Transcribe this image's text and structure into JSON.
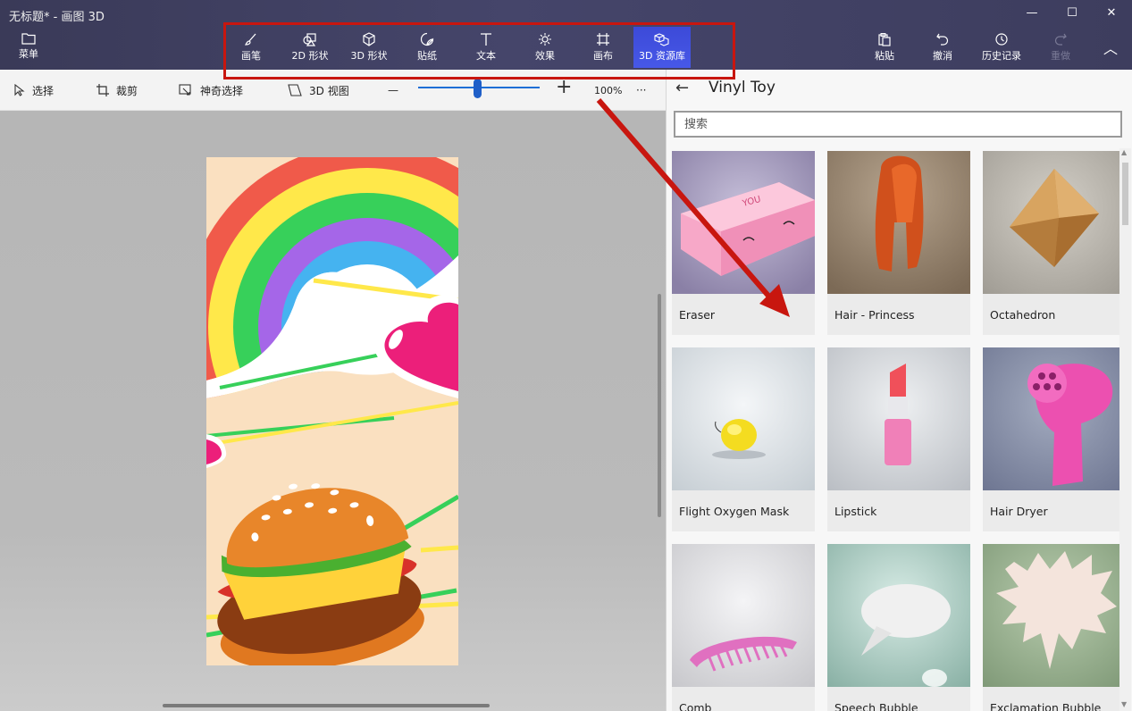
{
  "window": {
    "title": "无标题* - 画图 3D",
    "minimize": "—",
    "maximize": "☐",
    "close": "✕"
  },
  "ribbon": {
    "menu": "菜单",
    "tools": [
      {
        "label": "画笔",
        "icon": "brush-icon"
      },
      {
        "label": "2D 形状",
        "icon": "shapes-2d-icon"
      },
      {
        "label": "3D 形状",
        "icon": "cube-icon"
      },
      {
        "label": "贴纸",
        "icon": "sticker-icon"
      },
      {
        "label": "文本",
        "icon": "text-icon"
      },
      {
        "label": "效果",
        "icon": "effects-icon"
      },
      {
        "label": "画布",
        "icon": "canvas-icon"
      },
      {
        "label": "3D 资源库",
        "icon": "library-3d-icon",
        "active": true
      }
    ],
    "paste": "粘贴",
    "undo": "撤消",
    "history": "历史记录",
    "redo": "重做",
    "collapse": "︿"
  },
  "toolbar": {
    "select": "选择",
    "crop": "裁剪",
    "magic_select": "神奇选择",
    "view_3d": "3D 视图",
    "zoom_out": "—",
    "zoom_in": "+",
    "zoom_value": "100%",
    "zoom_fraction": 0.49,
    "more": "···"
  },
  "panel": {
    "back": "←",
    "title": "Vinyl Toy",
    "search_placeholder": "搜索",
    "items": [
      {
        "label": "Eraser"
      },
      {
        "label": "Hair - Princess"
      },
      {
        "label": "Octahedron"
      },
      {
        "label": "Flight Oxygen Mask"
      },
      {
        "label": "Lipstick"
      },
      {
        "label": "Hair Dryer"
      },
      {
        "label": "Comb"
      },
      {
        "label": "Speech Bubble"
      },
      {
        "label": "Exclamation Bubble"
      }
    ]
  },
  "colors": {
    "ribbon_bg": "#42426a",
    "active_tool": "#4758e8",
    "annotation": "#c8160f"
  }
}
